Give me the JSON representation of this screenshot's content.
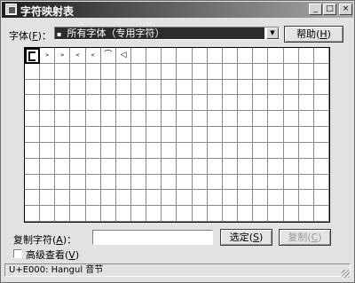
{
  "window": {
    "title": "字符映射表"
  },
  "titlebar_buttons": {
    "minimize": "_",
    "maximize": "□",
    "close": "×"
  },
  "font_row": {
    "label": "字体",
    "accel": "F",
    "selected_font": "所有字体（专用字符）",
    "help_button": "帮助",
    "help_accel": "H"
  },
  "grid": {
    "columns": 20,
    "rows": 11,
    "selected_index": 0,
    "chars": [
      "",
      "﹥",
      "﹥",
      "﹤",
      "﹤",
      "⌒",
      "◁"
    ]
  },
  "copy_row": {
    "label": "复制字符",
    "accel": "A",
    "value": "",
    "select_button": "选定",
    "select_accel": "S",
    "copy_button": "复制",
    "copy_accel": "C",
    "copy_disabled": true
  },
  "advanced": {
    "label": "高级查看",
    "accel": "V",
    "checked": false
  },
  "status_bar": {
    "text": "U+E000: Hangul 音节"
  }
}
